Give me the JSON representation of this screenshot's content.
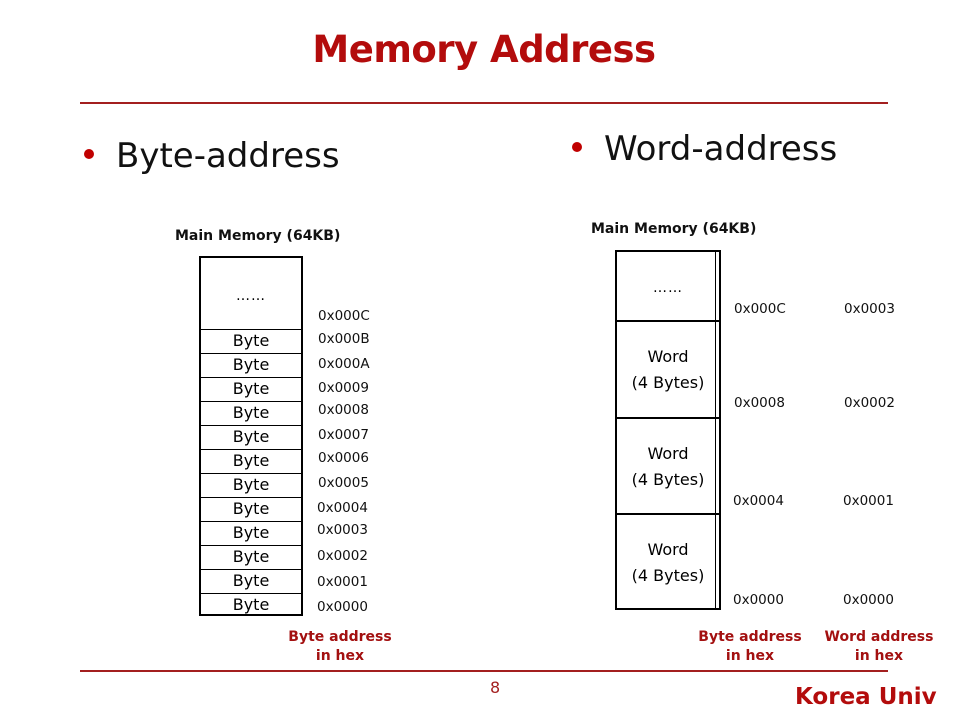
{
  "title": "Memory Address",
  "colors": {
    "accent": "#b30c0c",
    "rule": "#a31f1f",
    "bullet": "#c00000"
  },
  "left": {
    "bullet": "Byte-address",
    "memory_label": "Main Memory (64KB)",
    "ellipsis": "……",
    "cells": [
      "Byte",
      "Byte",
      "Byte",
      "Byte",
      "Byte",
      "Byte",
      "Byte",
      "Byte",
      "Byte",
      "Byte",
      "Byte",
      "Byte"
    ],
    "addresses": [
      "0x000C",
      "0x000B",
      "0x000A",
      "0x0009",
      "0x0008",
      "0x0007",
      "0x0006",
      "0x0005",
      "0x0004",
      "0x0003",
      "0x0002",
      "0x0001",
      "0x0000"
    ],
    "caption_line1": "Byte address",
    "caption_line2": "in hex"
  },
  "right": {
    "bullet": "Word-address",
    "memory_label": "Main Memory (64KB)",
    "ellipsis": "……",
    "words": [
      {
        "line1": "Word",
        "line2": "(4 Bytes)"
      },
      {
        "line1": "Word",
        "line2": "(4 Bytes)"
      },
      {
        "line1": "Word",
        "line2": "(4 Bytes)"
      }
    ],
    "byte_addresses": [
      "0x000C",
      "0x0008",
      "0x0004",
      "0x0000"
    ],
    "word_addresses": [
      "0x0003",
      "0x0002",
      "0x0001",
      "0x0000"
    ],
    "byte_caption_line1": "Byte address",
    "byte_caption_line2": "in hex",
    "word_caption_line1": "Word address",
    "word_caption_line2": "in hex"
  },
  "footer": {
    "page_number": "8",
    "brand": "Korea Univ"
  }
}
